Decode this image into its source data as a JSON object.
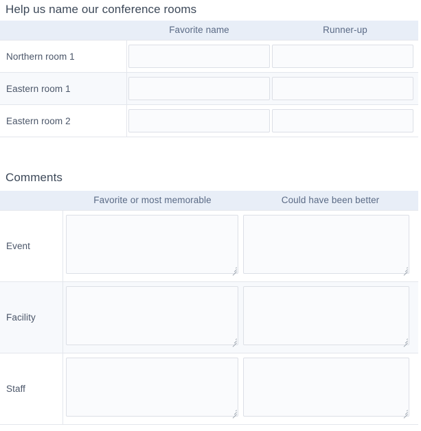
{
  "rooms_section": {
    "title": "Help us name our conference rooms",
    "columns": {
      "row_label": "",
      "favorite": "Favorite name",
      "runner_up": "Runner-up"
    },
    "rows": [
      {
        "label": "Northern room 1",
        "favorite_value": "",
        "runner_up_value": ""
      },
      {
        "label": "Eastern room 1",
        "favorite_value": "",
        "runner_up_value": ""
      },
      {
        "label": "Eastern room 2",
        "favorite_value": "",
        "runner_up_value": ""
      }
    ]
  },
  "comments_section": {
    "title": "Comments",
    "columns": {
      "row_label": "",
      "favorite_memorable": "Favorite or most memorable",
      "could_be_better": "Could have been better"
    },
    "rows": [
      {
        "label": "Event",
        "favorite_value": "",
        "better_value": ""
      },
      {
        "label": "Facility",
        "favorite_value": "",
        "better_value": ""
      },
      {
        "label": "Staff",
        "favorite_value": "",
        "better_value": ""
      }
    ]
  },
  "colors": {
    "header_background": "#e8eef7",
    "header_text": "#5a6a85",
    "title_text": "#3c4858",
    "row_stripe": "#f7f9fc",
    "field_border": "#dcdfe6",
    "field_background": "#fafbfd",
    "grid_line": "#e3e6ec"
  },
  "icons": {
    "resize_handle": "resize-grip-icon"
  }
}
